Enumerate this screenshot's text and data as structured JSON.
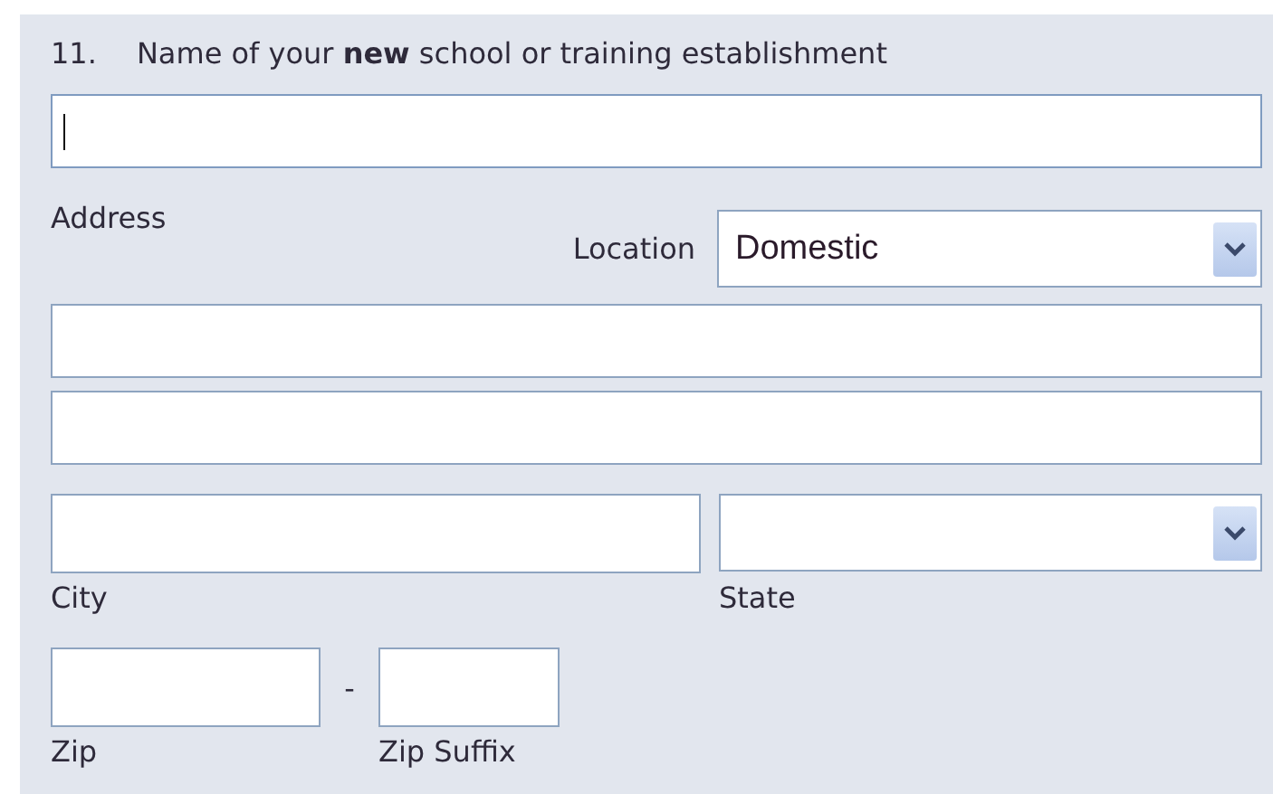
{
  "question": {
    "number": "11.",
    "label": "Name of your **new** school or training establishment"
  },
  "name_field": {
    "focused": true
  },
  "address": {
    "label": "Address",
    "location_label": "Location",
    "location_value": "Domestic"
  },
  "fields": {
    "city_label": "City",
    "state_label": "State",
    "zip_label": "Zip",
    "zip_separator": "-",
    "zip_suffix_label": "Zip Suffix"
  }
}
